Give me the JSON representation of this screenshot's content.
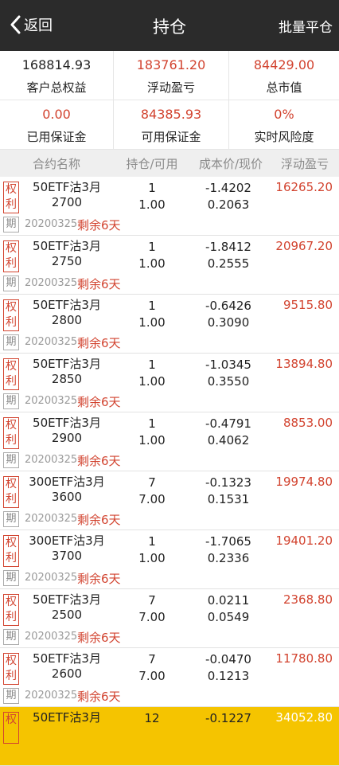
{
  "header": {
    "back_label": "返回",
    "title": "持仓",
    "batch_close_label": "批量平仓"
  },
  "summary": [
    {
      "value": "168814.93",
      "label": "客户总权益",
      "color": "#222222"
    },
    {
      "value": "183761.20",
      "label": "浮动盈亏",
      "color": "#d2432f"
    },
    {
      "value": "84429.00",
      "label": "总市值",
      "color": "#d2432f"
    },
    {
      "value": "0.00",
      "label": "已用保证金",
      "color": "#d2432f"
    },
    {
      "value": "84385.93",
      "label": "可用保证金",
      "color": "#d2432f"
    },
    {
      "value": "0%",
      "label": "实时风险度",
      "color": "#d2432f"
    }
  ],
  "table": {
    "columns": [
      "合约名称",
      "持仓/可用",
      "成本价/现价",
      "浮动盈亏"
    ],
    "rows": [
      {
        "badge_top": "权",
        "badge_bottom": "利",
        "period_badge": "期",
        "name_line1": "50ETF沽3月",
        "name_line2": "2700",
        "expiry": "20200325",
        "remain": "剩余6天",
        "position": "1",
        "available": "1.00",
        "cost": "-1.4202",
        "current": "0.2063",
        "pnl": "16265.20",
        "highlight": false
      },
      {
        "badge_top": "权",
        "badge_bottom": "利",
        "period_badge": "期",
        "name_line1": "50ETF沽3月",
        "name_line2": "2750",
        "expiry": "20200325",
        "remain": "剩余6天",
        "position": "1",
        "available": "1.00",
        "cost": "-1.8412",
        "current": "0.2555",
        "pnl": "20967.20",
        "highlight": false
      },
      {
        "badge_top": "权",
        "badge_bottom": "利",
        "period_badge": "期",
        "name_line1": "50ETF沽3月",
        "name_line2": "2800",
        "expiry": "20200325",
        "remain": "剩余6天",
        "position": "1",
        "available": "1.00",
        "cost": "-0.6426",
        "current": "0.3090",
        "pnl": "9515.80",
        "highlight": false
      },
      {
        "badge_top": "权",
        "badge_bottom": "利",
        "period_badge": "期",
        "name_line1": "50ETF沽3月",
        "name_line2": "2850",
        "expiry": "20200325",
        "remain": "剩余6天",
        "position": "1",
        "available": "1.00",
        "cost": "-1.0345",
        "current": "0.3550",
        "pnl": "13894.80",
        "highlight": false
      },
      {
        "badge_top": "权",
        "badge_bottom": "利",
        "period_badge": "期",
        "name_line1": "50ETF沽3月",
        "name_line2": "2900",
        "expiry": "20200325",
        "remain": "剩余6天",
        "position": "1",
        "available": "1.00",
        "cost": "-0.4791",
        "current": "0.4062",
        "pnl": "8853.00",
        "highlight": false
      },
      {
        "badge_top": "权",
        "badge_bottom": "利",
        "period_badge": "期",
        "name_line1": "300ETF沽3月",
        "name_line2": "3600",
        "expiry": "20200325",
        "remain": "剩余6天",
        "position": "7",
        "available": "7.00",
        "cost": "-0.1323",
        "current": "0.1531",
        "pnl": "19974.80",
        "highlight": false
      },
      {
        "badge_top": "权",
        "badge_bottom": "利",
        "period_badge": "期",
        "name_line1": "300ETF沽3月",
        "name_line2": "3700",
        "expiry": "20200325",
        "remain": "剩余6天",
        "position": "1",
        "available": "1.00",
        "cost": "-1.7065",
        "current": "0.2336",
        "pnl": "19401.20",
        "highlight": false
      },
      {
        "badge_top": "权",
        "badge_bottom": "利",
        "period_badge": "期",
        "name_line1": "50ETF沽3月",
        "name_line2": "2500",
        "expiry": "20200325",
        "remain": "剩余6天",
        "position": "7",
        "available": "7.00",
        "cost": "0.0211",
        "current": "0.0549",
        "pnl": "2368.80",
        "highlight": false
      },
      {
        "badge_top": "权",
        "badge_bottom": "利",
        "period_badge": "期",
        "name_line1": "50ETF沽3月",
        "name_line2": "2600",
        "expiry": "20200325",
        "remain": "剩余6天",
        "position": "7",
        "available": "7.00",
        "cost": "-0.0470",
        "current": "0.1213",
        "pnl": "11780.80",
        "highlight": false
      },
      {
        "badge_top": "权",
        "badge_bottom": "",
        "period_badge": "",
        "name_line1": "50ETF沽3月",
        "name_line2": "",
        "expiry": "",
        "remain": "",
        "position": "12",
        "available": "",
        "cost": "-0.1227",
        "current": "",
        "pnl": "34052.80",
        "highlight": true
      }
    ]
  },
  "colors": {
    "header_bg": "#2b2b2b",
    "accent_red": "#d2432f",
    "highlight_row": "#f5c400"
  }
}
